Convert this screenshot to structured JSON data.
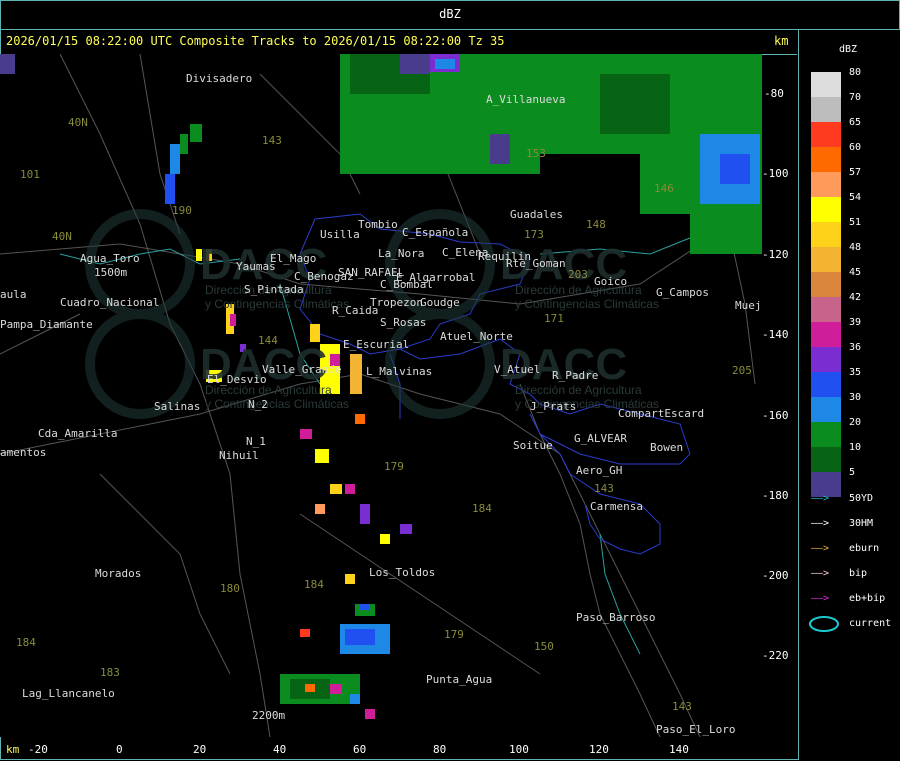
{
  "top_title": "dBZ",
  "header": {
    "title": "2026/01/15 08:22:00 UTC Composite Tracks to 2026/01/15 08:22:00 Tz 35",
    "km_label": "km"
  },
  "y_axis": {
    "labels": [
      "-80",
      "-100",
      "-120",
      "-140",
      "-160",
      "-180",
      "-200",
      "-220"
    ]
  },
  "x_axis": {
    "km_label": "km",
    "labels": [
      "-20",
      "0",
      "20",
      "40",
      "60",
      "80",
      "100",
      "120",
      "140"
    ]
  },
  "legend": {
    "title": "dBZ",
    "scale": [
      {
        "value": "80",
        "color": "#dcdcdc"
      },
      {
        "value": "70",
        "color": "#bdbdbd"
      },
      {
        "value": "65",
        "color": "#ff3a1e"
      },
      {
        "value": "60",
        "color": "#ff6a00"
      },
      {
        "value": "57",
        "color": "#ff9a5a"
      },
      {
        "value": "54",
        "color": "#ffff00"
      },
      {
        "value": "51",
        "color": "#ffd21a"
      },
      {
        "value": "48",
        "color": "#f2b432"
      },
      {
        "value": "45",
        "color": "#d9863c"
      },
      {
        "value": "42",
        "color": "#c8648c"
      },
      {
        "value": "39",
        "color": "#d01e9a"
      },
      {
        "value": "36",
        "color": "#7a2ed2"
      },
      {
        "value": "35",
        "color": "#2050f0"
      },
      {
        "value": "30",
        "color": "#1e88e6"
      },
      {
        "value": "20",
        "color": "#0a8c1e"
      },
      {
        "value": "10",
        "color": "#066414"
      },
      {
        "value": "5",
        "color": "#4a3c8c"
      }
    ],
    "tracks": [
      {
        "label": "50YD",
        "color": "#1ec8d2"
      },
      {
        "label": "30HM",
        "color": "#ffffff"
      },
      {
        "label": "eburn",
        "color": "#f0b43c"
      },
      {
        "label": "bip",
        "color": "#ffd2dc"
      },
      {
        "label": "eb+bip",
        "color": "#e628e6"
      }
    ],
    "current_label": "current",
    "current_color": "#1ec8d2"
  },
  "places": [
    "Divisadero",
    "A_Villanueva",
    "Guadales",
    "Tombio",
    "Usilla",
    "C_Española",
    "La_Nora",
    "C_Elena",
    "Requilin",
    "Rte_Goman",
    "Agua_Toro",
    "Yaumas",
    "El_Mago",
    "C_Benogaz",
    "SAN_RAFAEL",
    "E_Algarrobal",
    "C_Bombal",
    "Goico",
    "G_Campos",
    "Mueje",
    "S_Pintada",
    "Cuadro_Nacional",
    "Pampa_Diamante",
    "R_Caida",
    "Tropezon",
    "Goudge",
    "S_Rosas",
    "Atuel_Norte",
    "E_Escurial",
    "Valle_Grande",
    "L_Malvinas",
    "El_Desvio",
    "V_Atuel",
    "R_Padre",
    "Salinas",
    "N_2",
    "J_Prats",
    "CompartEscard",
    "Cda_Amarilla",
    "N_1",
    "Nihuil",
    "G_ALVEAR",
    "Soitue",
    "Bowen",
    "Aero_GH",
    "Carmensa",
    "Morados",
    "Los_Toldos",
    "Paso_Barroso",
    "Punta_Agua",
    "Lag_Llancanelo",
    "Paso_El_Loro",
    "amentos",
    "aula",
    "1500m",
    "2200m"
  ],
  "route_numbers": [
    "101",
    "143",
    "153",
    "146",
    "148",
    "173",
    "203",
    "171",
    "143",
    "184",
    "179",
    "184",
    "180",
    "179",
    "150",
    "183",
    "184",
    "143",
    "205",
    "40N",
    "40N",
    "190",
    "144"
  ],
  "watermark": {
    "brand": "DACC",
    "subtitle_1": "Dirección de Agricultura",
    "subtitle_2": "y Contingencias Climáticas"
  }
}
